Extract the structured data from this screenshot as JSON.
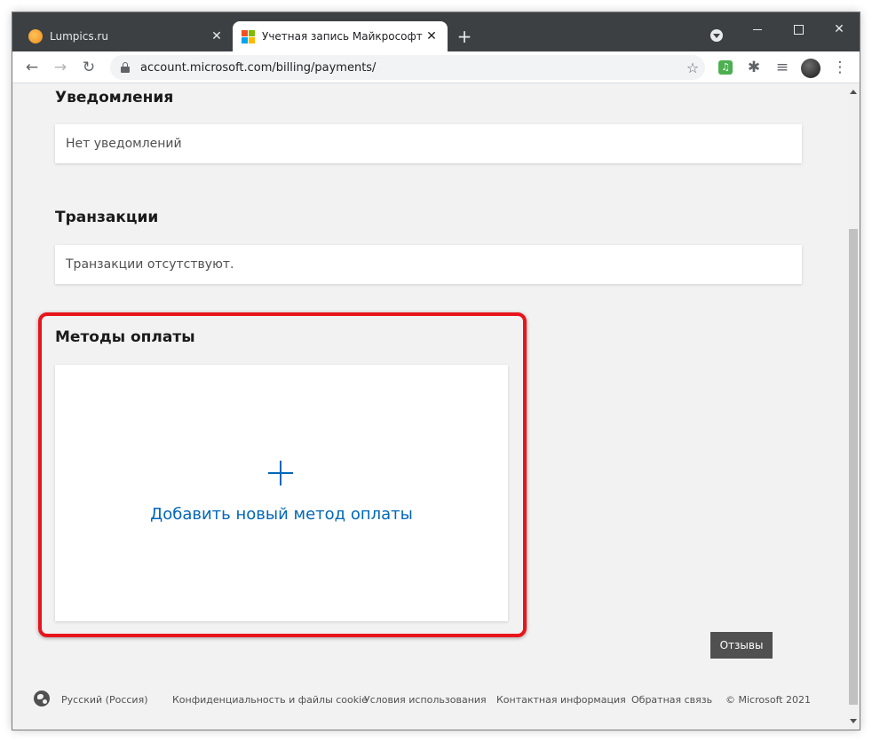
{
  "browser": {
    "tabs": [
      {
        "title": "Lumpics.ru",
        "active": false
      },
      {
        "title": "Учетная запись Майкрософт | с",
        "active": true
      }
    ],
    "new_tab": "+",
    "url": "account.microsoft.com/billing/payments/",
    "avatar": "user-avatar"
  },
  "page": {
    "sections": {
      "notifications": {
        "title": "Уведомления",
        "empty_text": "Нет уведомлений"
      },
      "transactions": {
        "title": "Транзакции",
        "empty_text": "Транзакции отсутствуют."
      },
      "payment_methods": {
        "title": "Методы оплаты",
        "add_label": "Добавить новый метод оплаты"
      }
    },
    "highlight_color": "#e8141c",
    "link_color": "#0067b8"
  },
  "footer": {
    "language": "Русский (Россия)",
    "links": [
      "Конфиденциальность и файлы cookie",
      "Условия использования",
      "Контактная информация",
      "Обратная связь"
    ],
    "copyright": "© Microsoft 2021",
    "feedback_button": "Отзывы"
  }
}
